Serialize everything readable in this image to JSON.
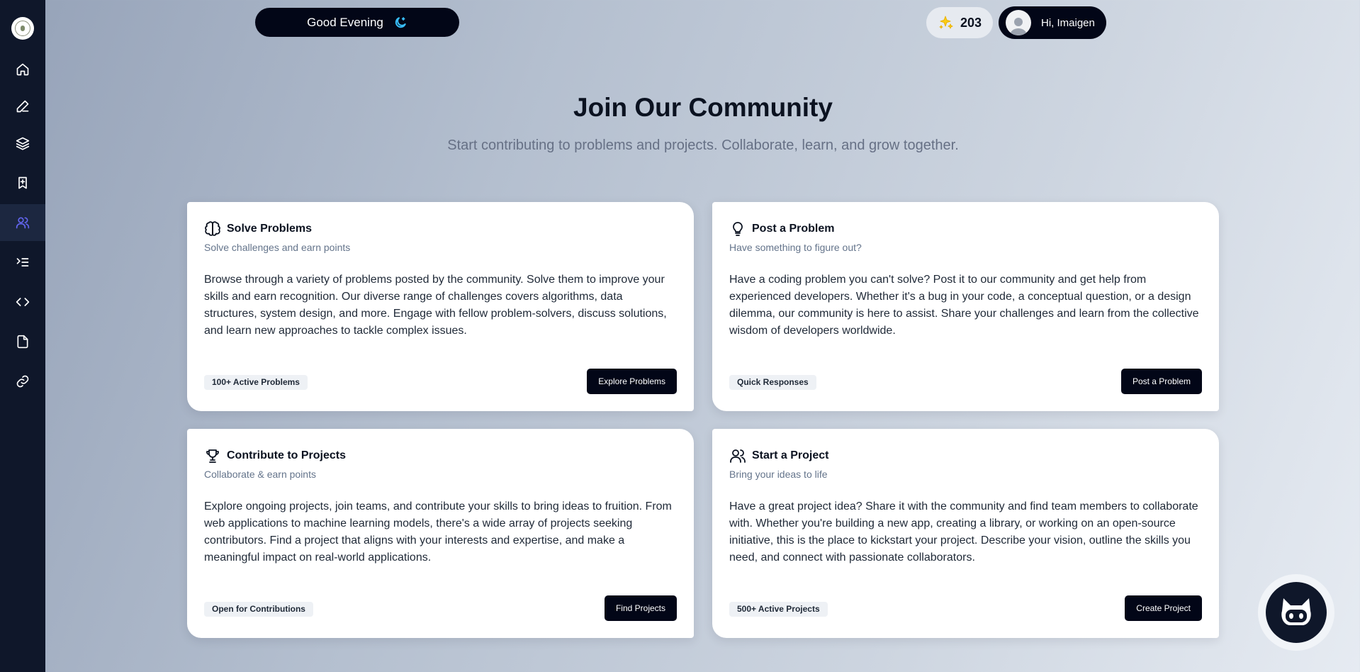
{
  "sidebar": {
    "logo_icon": "emblem-logo-icon",
    "items": [
      {
        "icon": "home-icon",
        "active": false
      },
      {
        "icon": "pencil-icon",
        "active": false
      },
      {
        "icon": "layers-icon",
        "active": false
      },
      {
        "icon": "bookmark-icon",
        "active": false
      },
      {
        "icon": "users-icon",
        "active": true
      },
      {
        "icon": "list-terminal-icon",
        "active": false
      },
      {
        "icon": "code-icon",
        "active": false
      },
      {
        "icon": "file-icon",
        "active": false
      },
      {
        "icon": "link-icon",
        "active": false
      }
    ]
  },
  "header": {
    "greeting": "Good Evening",
    "greeting_icon": "moon-icon",
    "points": "203",
    "points_icon": "sparkles-icon",
    "user_greeting": "Hi, Imaigen",
    "avatar_icon": "user-avatar-icon"
  },
  "hero": {
    "title": "Join Our Community",
    "subtitle": "Start contributing to problems and projects. Collaborate, learn, and grow together."
  },
  "cards": [
    {
      "icon": "brain-icon",
      "title": "Solve Problems",
      "subtitle": "Solve challenges and earn points",
      "description": "Browse through a variety of problems posted by the community. Solve them to improve your skills and earn recognition. Our diverse range of challenges covers algorithms, data structures, system design, and more. Engage with fellow problem-solvers, discuss solutions, and learn new approaches to tackle complex issues.",
      "badge": "100+ Active Problems",
      "button": "Explore Problems"
    },
    {
      "icon": "lightbulb-icon",
      "title": "Post a Problem",
      "subtitle": "Have something to figure out?",
      "description": "Have a coding problem you can't solve? Post it to our community and get help from experienced developers. Whether it's a bug in your code, a conceptual question, or a design dilemma, our community is here to assist. Share your challenges and learn from the collective wisdom of developers worldwide.",
      "badge": "Quick Responses",
      "button": "Post a Problem"
    },
    {
      "icon": "trophy-icon",
      "title": "Contribute to Projects",
      "subtitle": "Collaborate & earn points",
      "description": "Explore ongoing projects, join teams, and contribute your skills to bring ideas to fruition. From web applications to machine learning models, there's a wide array of projects seeking contributors. Find a project that aligns with your interests and expertise, and make a meaningful impact on real-world applications.",
      "badge": "Open for Contributions",
      "button": "Find Projects"
    },
    {
      "icon": "users-icon",
      "title": "Start a Project",
      "subtitle": "Bring your ideas to life",
      "description": "Have a great project idea? Share it with the community and find team members to collaborate with. Whether you're building a new app, creating a library, or working on an open-source initiative, this is the place to kickstart your project. Describe your vision, outline the skills you need, and connect with passionate collaborators.",
      "badge": "500+ Active Projects",
      "button": "Create Project"
    }
  ],
  "chatbot": {
    "icon": "octocat-bot-icon"
  },
  "colors": {
    "sidebar_bg": "#0f172a",
    "pill_bg": "#020617",
    "active_nav_icon": "#6366f1",
    "moon": "#38bdf8",
    "sparkle": "#facc15"
  }
}
